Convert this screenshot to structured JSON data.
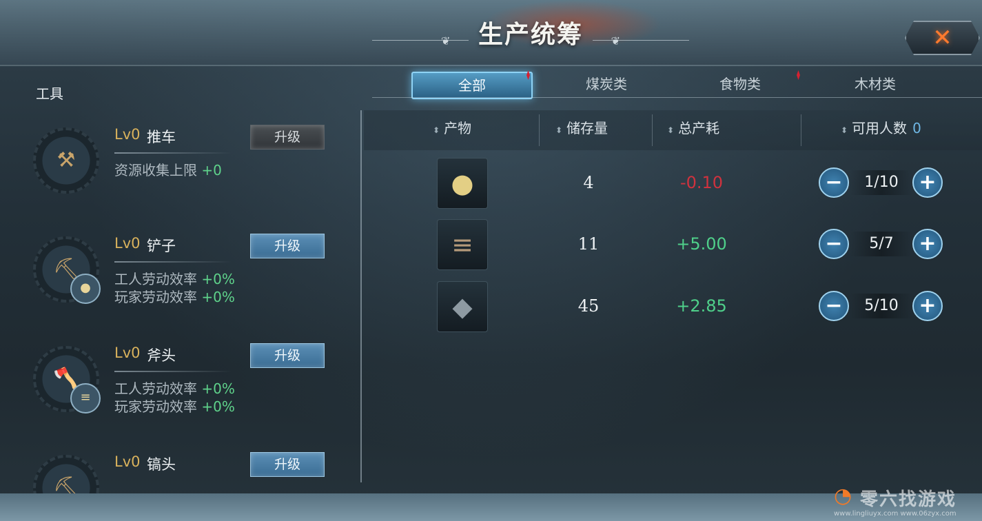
{
  "header": {
    "title": "生产统筹",
    "close_icon": "close-x-icon"
  },
  "tools": {
    "title": "工具",
    "items": [
      {
        "level": "Lv0",
        "name": "推车",
        "upgrade_label": "升级",
        "upgrade_enabled": false,
        "icon": "cart-icon",
        "stats": [
          {
            "label": "资源收集上限",
            "value": "+0"
          }
        ]
      },
      {
        "level": "Lv0",
        "name": "铲子",
        "upgrade_label": "升级",
        "upgrade_enabled": true,
        "icon": "shovel-icon",
        "badge_icon": "potato-icon",
        "stats": [
          {
            "label": "工人劳动效率",
            "value": "+0%"
          },
          {
            "label": "玩家劳动效率",
            "value": "+0%"
          }
        ]
      },
      {
        "level": "Lv0",
        "name": "斧头",
        "upgrade_label": "升级",
        "upgrade_enabled": true,
        "icon": "axe-icon",
        "badge_icon": "wood-icon",
        "stats": [
          {
            "label": "工人劳动效率",
            "value": "+0%"
          },
          {
            "label": "玩家劳动效率",
            "value": "+0%"
          }
        ]
      },
      {
        "level": "Lv0",
        "name": "镐头",
        "upgrade_label": "升级",
        "upgrade_enabled": true,
        "icon": "pickaxe-icon",
        "stats": []
      }
    ]
  },
  "tabs": [
    {
      "label": "全部",
      "active": true,
      "alert": true
    },
    {
      "label": "煤炭类",
      "active": false,
      "alert": false
    },
    {
      "label": "食物类",
      "active": false,
      "alert": true
    },
    {
      "label": "木材类",
      "active": false,
      "alert": false
    }
  ],
  "table": {
    "headers": {
      "product": "产物",
      "stock": "储存量",
      "consumption": "总产耗",
      "workers": "可用人数",
      "workers_count": "0"
    },
    "rows": [
      {
        "icon": "potato-icon",
        "stock": "4",
        "consumption": "-0.10",
        "consumption_sign": "negative",
        "workers": "1/10"
      },
      {
        "icon": "wood-log-icon",
        "stock": "11",
        "consumption": "+5.00",
        "consumption_sign": "positive",
        "workers": "5/7"
      },
      {
        "icon": "coal-icon",
        "stock": "45",
        "consumption": "+2.85",
        "consumption_sign": "positive",
        "workers": "5/10"
      }
    ]
  },
  "colors": {
    "accent": "#5fb4e6",
    "positive": "#4fd08a",
    "negative": "#d0323e",
    "level": "#d9b25c"
  },
  "watermark": {
    "text": "零六找游戏",
    "url": "www.lingliuyx.com www.06zyx.com"
  }
}
